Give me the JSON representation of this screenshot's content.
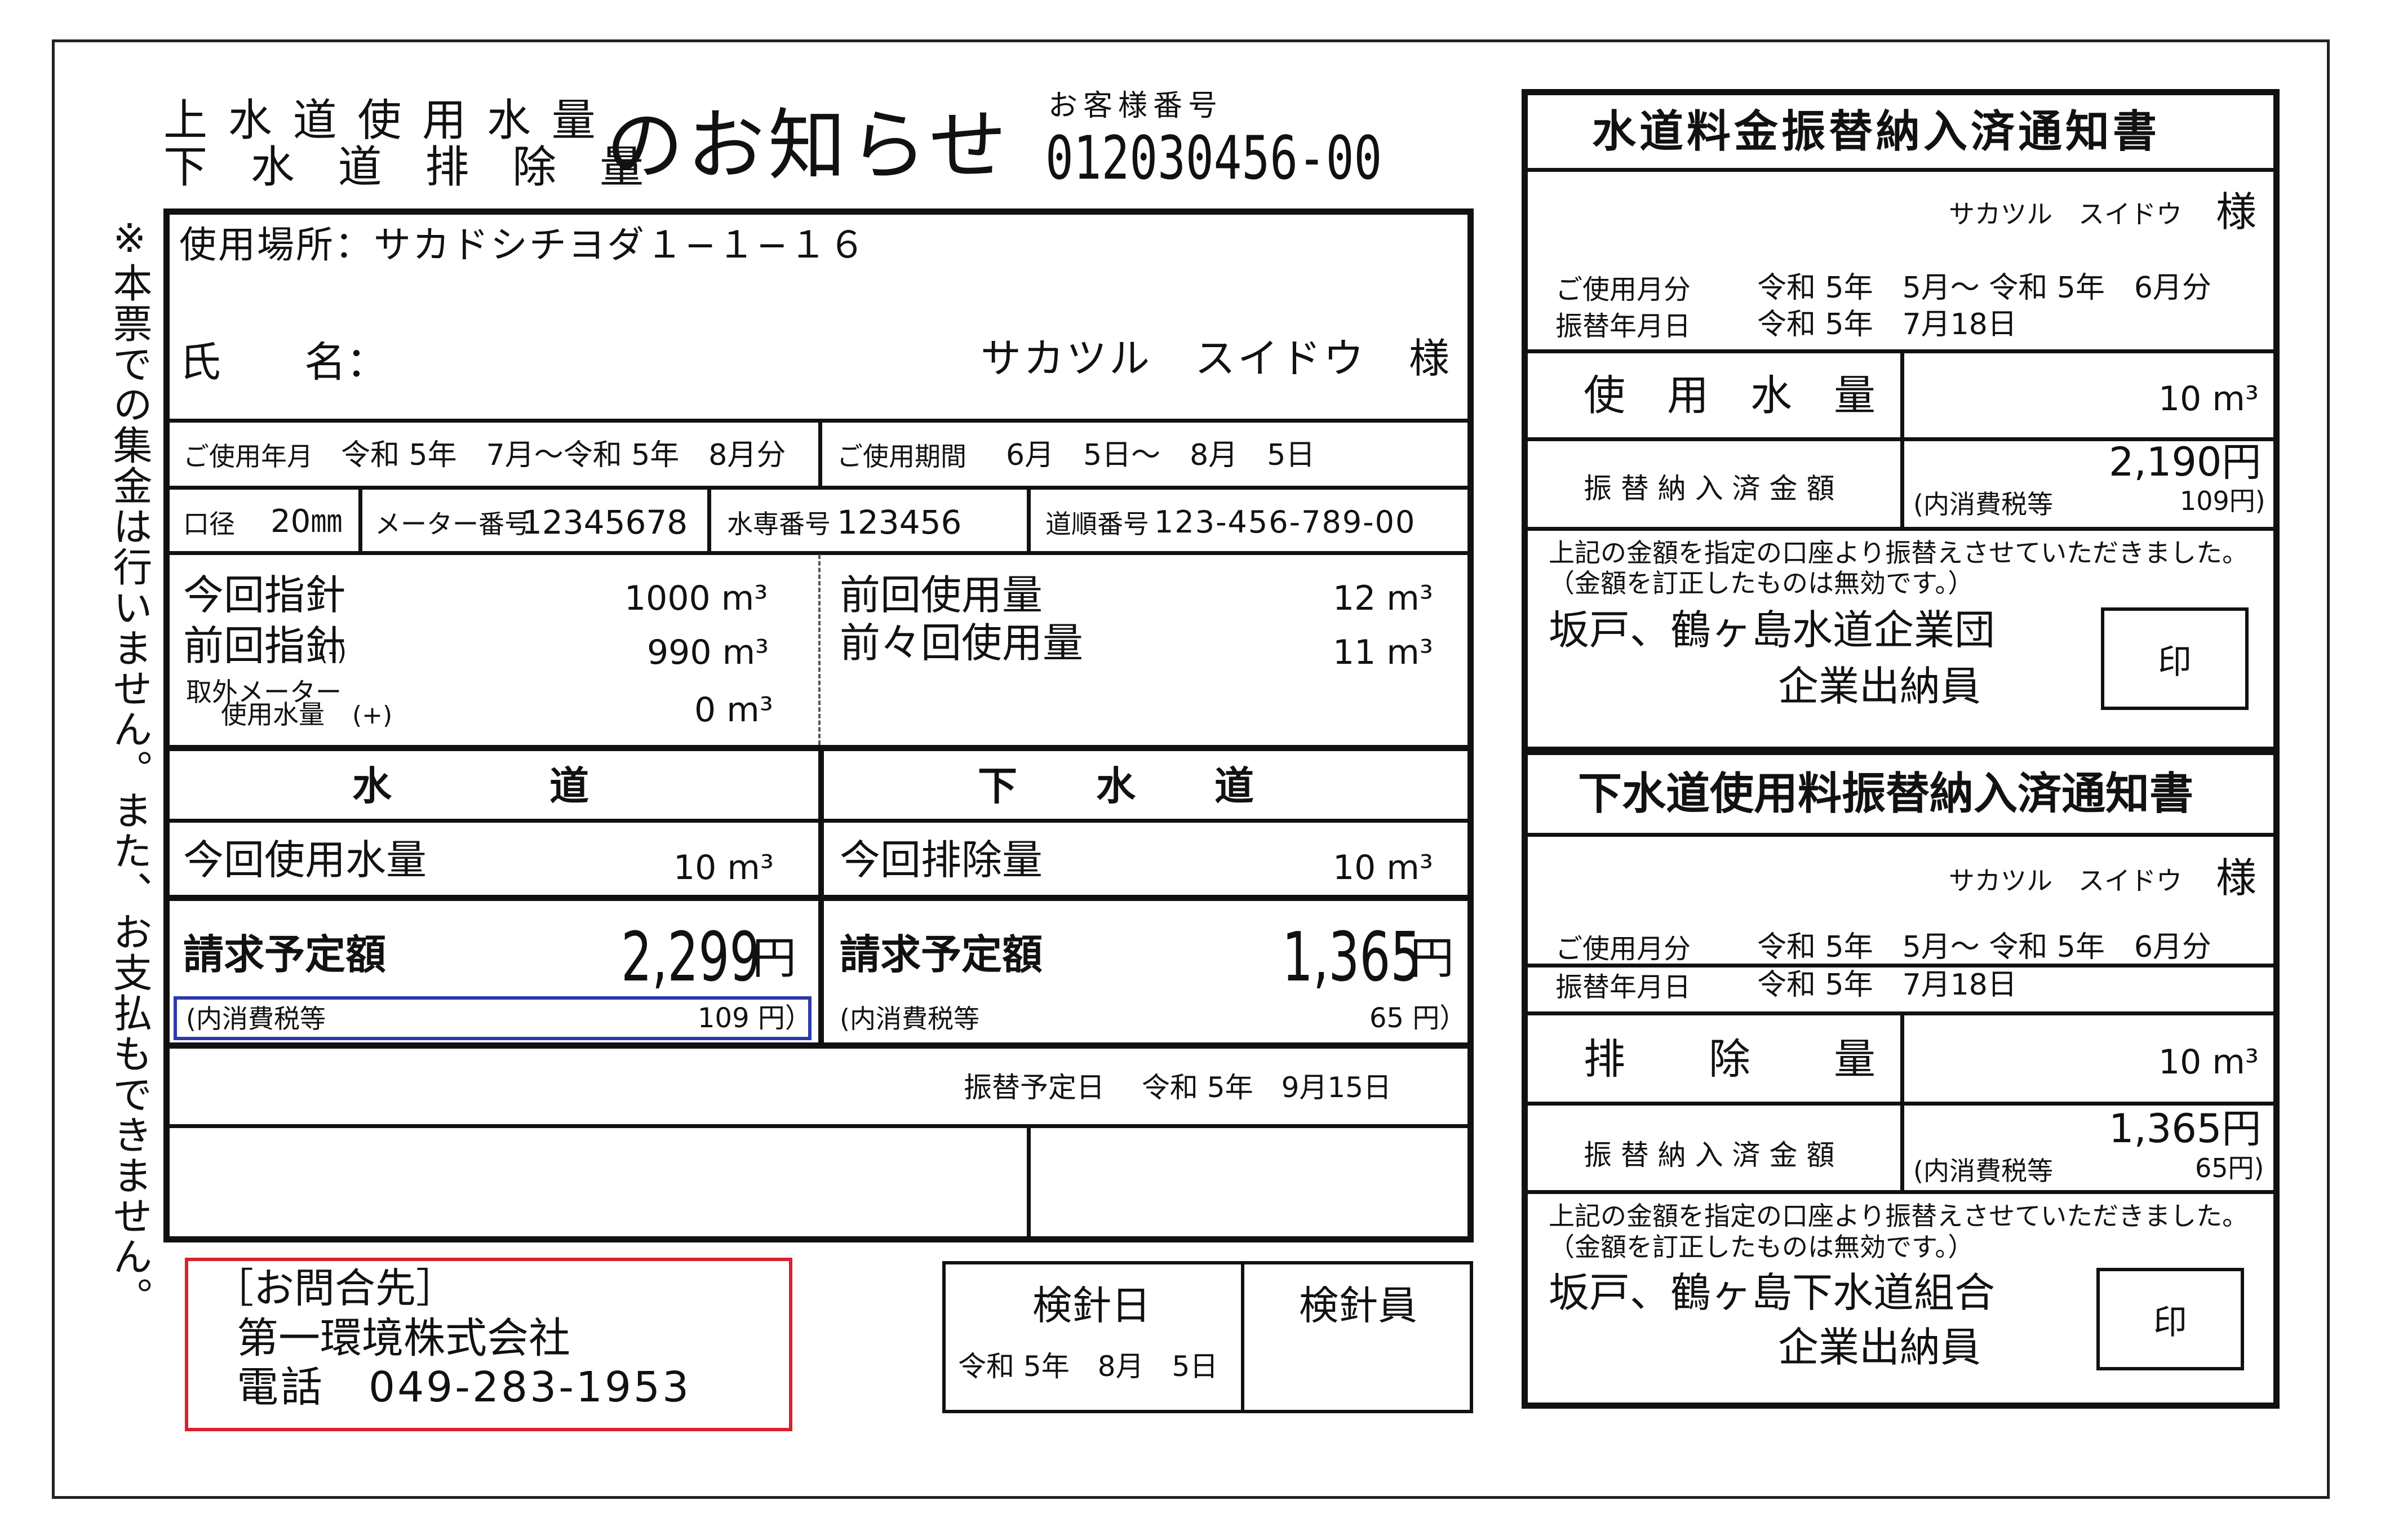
{
  "notice": {
    "title_line1": "上 水 道 使 用 水 量",
    "title_line2": "下 水 道 排 除 量",
    "title_suffix": "のお知らせ",
    "customer_no_label": "お客様番号",
    "customer_no": "012030456-00",
    "vertical_note": "※本票での集金は行いません。また、お支払もできません。",
    "place_label": "使用場所：サカドシチヨダ１−１−１６",
    "name_label": "氏　　名：",
    "name_value": "サカツル　スイドウ　様",
    "period_month_label": "ご使用年月",
    "period_month_value": "令和 5年　7月〜令和 5年　8月分",
    "period_label": "ご使用期間",
    "period_value": "6月　5日〜　8月　5日",
    "caliber_label": "口径",
    "caliber_value": "20㎜",
    "meter_label": "メーター番号",
    "meter_value": "12345678",
    "dedicated_label": "水専番号",
    "dedicated_value": "123456",
    "route_label": "道順番号",
    "route_value": "123-456-789-00",
    "current_reading_label": "今回指針",
    "current_reading_value": "1000 m³",
    "previous_reading_label": "前回指針",
    "previous_reading_suffix": "(-)",
    "previous_reading_value": "990 m³",
    "external_label_1": "取外メーター",
    "external_label_2": "使用水量",
    "external_suffix": "(+)",
    "external_value": "0 m³",
    "prev_usage_label": "前回使用量",
    "prev_usage_value": "12 m³",
    "prev2_usage_label": "前々回使用量",
    "prev2_usage_value": "11 m³",
    "water_header": "水　　　　道",
    "sewer_header": "下　　水　　道",
    "water_usage_label": "今回使用水量",
    "water_usage_value": "10 m³",
    "sewer_usage_label": "今回排除量",
    "sewer_usage_value": "10 m³",
    "water_bill_label": "請求予定額",
    "water_bill_amount": "2,299",
    "yen": "円",
    "water_tax_label": "(内消費税等",
    "water_tax_value": "109 円）",
    "sewer_bill_label": "請求予定額",
    "sewer_bill_amount": "1,365",
    "sewer_tax_label": "(内消費税等",
    "sewer_tax_value": "65 円）",
    "transfer_date": "振替予定日　 令和 5年　9月15日",
    "contact_label": "［お問合先］",
    "contact_company": "第一環境株式会社",
    "contact_phone": "電話　049-283-1953",
    "reading_date_label": "検針日",
    "reading_date_value": "令和 5年　8月　5日",
    "reader_label": "検針員"
  },
  "water_receipt": {
    "title": "水道料金振替納入済通知書",
    "customer": "サカツル　スイドウ",
    "sama": "様",
    "month_label": "ご使用月分",
    "month_value": "令和 5年　5月〜 令和 5年　6月分",
    "date_label": "振替年月日",
    "date_value": "令和 5年　7月18日",
    "usage_label": "使　用　水　量",
    "usage_value": "10 m³",
    "paid_label": "振 替 納 入 済 金 額",
    "paid_value": "2,190円",
    "tax_label": "(内消費税等",
    "tax_value": "109円)",
    "note1": "上記の金額を指定の口座より振替えさせていただきました。",
    "note2": "（金額を訂正したものは無効です。）",
    "org": "坂戸、鶴ヶ島水道企業団",
    "officer": "企業出納員",
    "seal": "印"
  },
  "sewer_receipt": {
    "title": "下水道使用料振替納入済通知書",
    "customer": "サカツル　スイドウ",
    "sama": "様",
    "month_label": "ご使用月分",
    "month_value": "令和 5年　5月〜 令和 5年　6月分",
    "date_label": "振替年月日",
    "date_value": "令和 5年　7月18日",
    "usage_label": "排　　除　　量",
    "usage_value": "10 m³",
    "paid_label": "振 替 納 入 済 金 額",
    "paid_value": "1,365円",
    "tax_label": "(内消費税等",
    "tax_value": "65円)",
    "note1": "上記の金額を指定の口座より振替えさせていただきました。",
    "note2": "（金額を訂正したものは無効です。）",
    "org": "坂戸、鶴ヶ島下水道組合",
    "officer": "企業出納員",
    "seal": "印"
  },
  "colors": {
    "highlight_blue": "#2b3aa8",
    "highlight_red": "#d8222b"
  }
}
